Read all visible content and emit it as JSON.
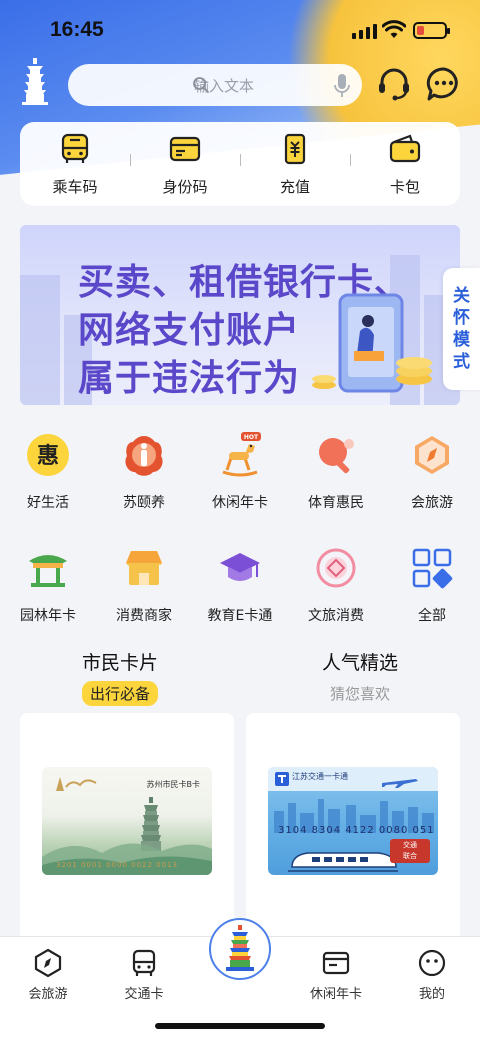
{
  "status_bar": {
    "time": "16:45"
  },
  "header": {
    "search_placeholder": "输入文本"
  },
  "quick_actions": [
    {
      "label": "乘车码",
      "icon": "bus-code-icon"
    },
    {
      "label": "身份码",
      "icon": "id-card-icon"
    },
    {
      "label": "充值",
      "icon": "recharge-icon"
    },
    {
      "label": "卡包",
      "icon": "wallet-icon"
    }
  ],
  "banner": {
    "line1": "买卖、租借银行卡、",
    "line2": "网络支付账户",
    "line3": "属于违法行为"
  },
  "care_mode": "关怀模式",
  "grid_row1": [
    {
      "label": "好生活",
      "icon": "hui-icon"
    },
    {
      "label": "苏颐养",
      "icon": "eldercare-icon"
    },
    {
      "label": "休闲年卡",
      "icon": "rocking-horse-icon",
      "badge": "HOT"
    },
    {
      "label": "体育惠民",
      "icon": "ping-pong-icon"
    },
    {
      "label": "会旅游",
      "icon": "compass-icon"
    }
  ],
  "grid_row2": [
    {
      "label": "园林年卡",
      "icon": "pavilion-icon"
    },
    {
      "label": "消费商家",
      "icon": "store-icon"
    },
    {
      "label": "教育E卡通",
      "icon": "graduation-cap-icon"
    },
    {
      "label": "文旅消费",
      "icon": "culture-icon"
    },
    {
      "label": "全部",
      "icon": "grid-all-icon"
    }
  ],
  "sections": {
    "left": {
      "title": "市民卡片",
      "subtitle": "出行必备"
    },
    "right": {
      "title": "人气精选",
      "subtitle": "猜您喜欢"
    }
  },
  "cards": {
    "card1": {
      "title": "苏州市民卡B卡",
      "number": "3201 0001 0000 0022 0013"
    },
    "card2": {
      "title": "江苏交通一卡通",
      "number": "3104 8304 4122 0080 051",
      "badge_line1": "交通",
      "badge_line2": "联合"
    }
  },
  "bottom_nav": [
    {
      "label": "会旅游",
      "icon": "compass-nav-icon"
    },
    {
      "label": "交通卡",
      "icon": "bus-nav-icon"
    },
    {
      "label": "",
      "icon": "tiger-hill-pagoda-icon"
    },
    {
      "label": "休闲年卡",
      "icon": "card-nav-icon"
    },
    {
      "label": "我的",
      "icon": "profile-face-icon"
    }
  ],
  "colors": {
    "primary": "#3a6ee8",
    "accent_yellow": "#fcd43c",
    "banner_text": "#5b47c9"
  }
}
